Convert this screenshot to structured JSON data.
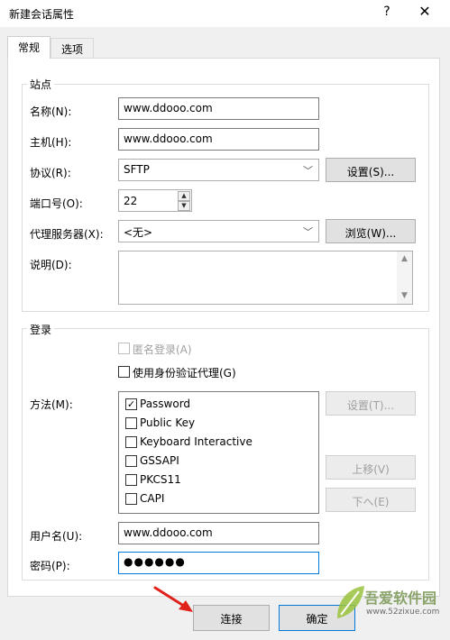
{
  "window": {
    "title": "新建会话属性",
    "help": "?",
    "close": "✕"
  },
  "tabs": [
    {
      "label": "常规",
      "active": true
    },
    {
      "label": "选项",
      "active": false
    }
  ],
  "site": {
    "group_label": "站点",
    "name_label": "名称(N):",
    "name_value": "www.ddooo.com",
    "host_label": "主机(H):",
    "host_value": "www.ddooo.com",
    "protocol_label": "协议(R):",
    "protocol_value": "SFTP",
    "protocol_settings": "设置(S)...",
    "port_label": "端口号(O):",
    "port_value": "22",
    "proxy_label": "代理服务器(X):",
    "proxy_value": "<无>",
    "proxy_browse": "浏览(W)...",
    "desc_label": "说明(D):"
  },
  "login": {
    "group_label": "登录",
    "anonymous_label": "匿名登录(A)",
    "agent_label": "使用身份验证代理(G)",
    "method_label": "方法(M):",
    "methods": [
      {
        "label": "Password",
        "checked": true
      },
      {
        "label": "Public Key",
        "checked": false
      },
      {
        "label": "Keyboard Interactive",
        "checked": false
      },
      {
        "label": "GSSAPI",
        "checked": false
      },
      {
        "label": "PKCS11",
        "checked": false
      },
      {
        "label": "CAPI",
        "checked": false
      }
    ],
    "method_settings": "设置(T)...",
    "move_up": "上移(V)",
    "move_down": "下へ(E)",
    "user_label": "用户名(U):",
    "user_value": "www.ddooo.com",
    "password_label": "密码(P):",
    "password_value": "●●●●●●"
  },
  "footer": {
    "connect": "连接",
    "ok": "确定"
  },
  "watermark": {
    "text": "吾爱软件园",
    "url": "www.52zixue.com"
  },
  "icons": {
    "check": "✓",
    "spin_up": "▲",
    "spin_down": "▼",
    "dropdown": "﹀"
  }
}
